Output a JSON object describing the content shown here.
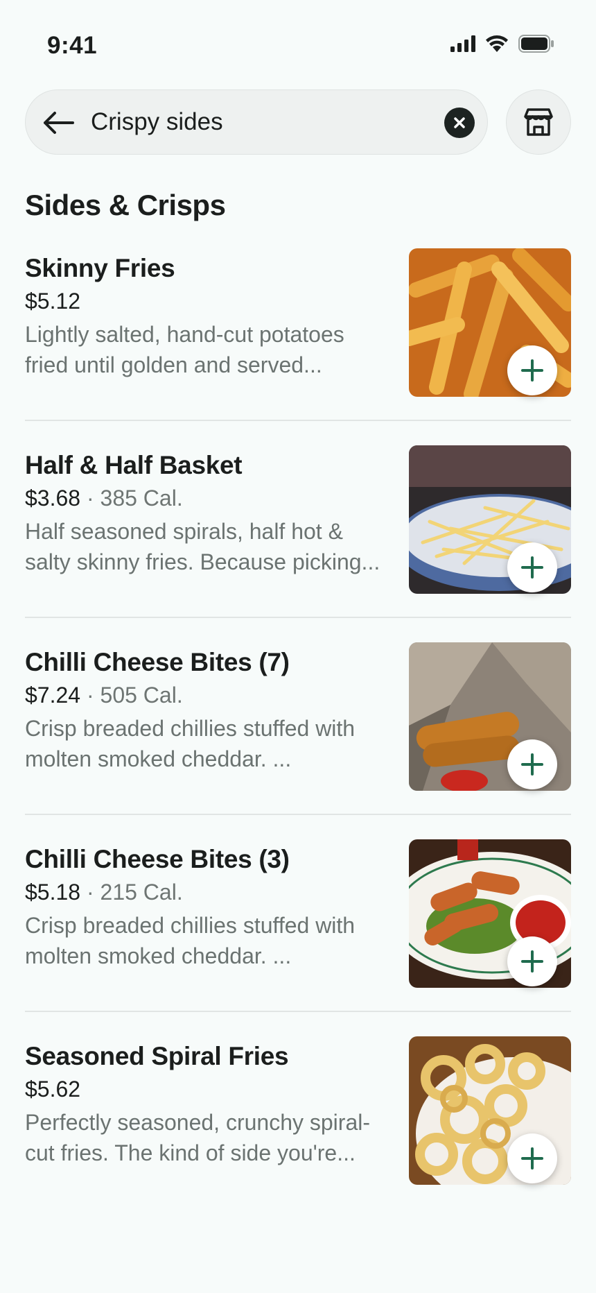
{
  "status_bar": {
    "time": "9:41"
  },
  "search": {
    "query": "Crispy sides"
  },
  "section": {
    "title": "Sides & Crisps"
  },
  "colors": {
    "accent": "#1f6b4e",
    "background": "#f7fbfa",
    "muted_text": "#6b7371"
  },
  "icons": {
    "back": "arrow-left",
    "clear": "close-circle",
    "store": "storefront",
    "add": "plus"
  },
  "items": [
    {
      "name": "Skinny Fries",
      "price": "$5.12",
      "calories": "",
      "description_line1": "Lightly salted, hand-cut potatoes",
      "description_line2": "fried until golden and served..."
    },
    {
      "name": "Half & Half Basket",
      "price": "$3.68",
      "calories": "385 Cal.",
      "description_line1": "Half seasoned spirals, half hot &",
      "description_line2": "salty skinny fries. Because picking..."
    },
    {
      "name": "Chilli Cheese Bites (7)",
      "price": "$7.24",
      "calories": "505 Cal.",
      "description_line1": "Crisp breaded chillies stuffed with",
      "description_line2": "molten smoked cheddar. ..."
    },
    {
      "name": "Chilli Cheese Bites (3)",
      "price": "$5.18",
      "calories": "215 Cal.",
      "description_line1": "Crisp breaded chillies stuffed with",
      "description_line2": "molten smoked cheddar. ..."
    },
    {
      "name": "Seasoned Spiral Fries",
      "price": "$5.62",
      "calories": "",
      "description_line1": "Perfectly seasoned, crunchy spiral-",
      "description_line2": "cut fries. The kind of side you're..."
    }
  ]
}
